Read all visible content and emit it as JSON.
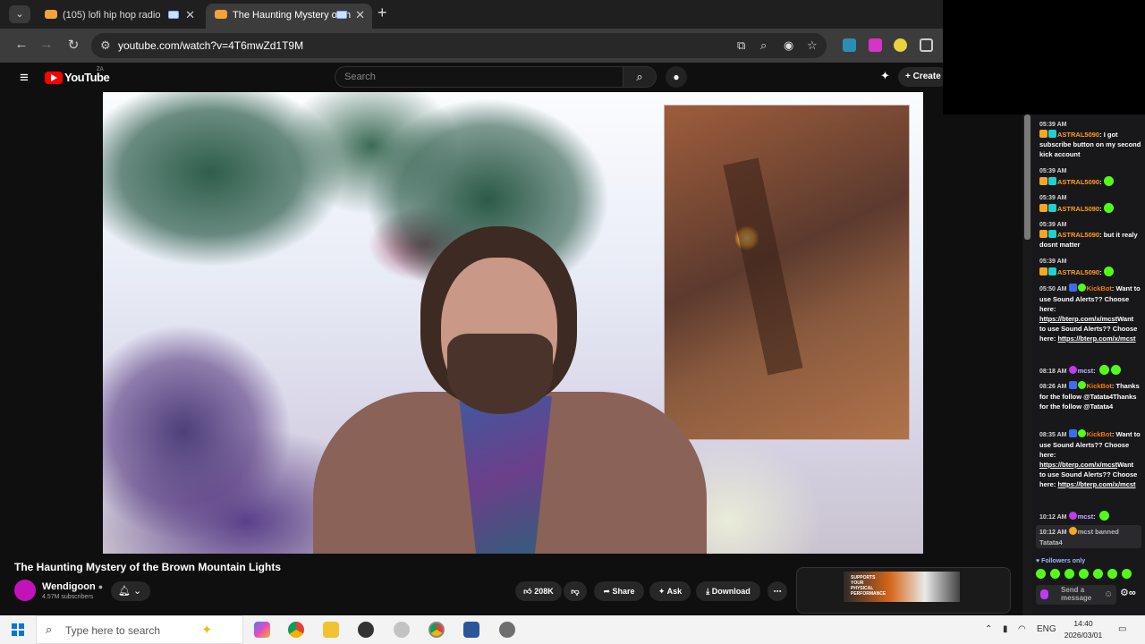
{
  "browser": {
    "tabs": [
      {
        "title": "(105) lofi hip hop radio",
        "close": "✕"
      },
      {
        "title": "The Haunting Mystery of th",
        "close": "✕",
        "active": true
      }
    ],
    "new_tab": "+",
    "url": "youtube.com/watch?v=4T6mwZd1T9M"
  },
  "youtube": {
    "logo_text": "YouTube",
    "region": "ZA",
    "search_placeholder": "Search",
    "create_label": "Create",
    "video_title": "The Haunting Mystery of the Brown Mountain Lights",
    "channel_name": "Wendigoon",
    "subscribers": "4.57M subscribers",
    "like_count": "208K",
    "share_label": "Share",
    "ask_label": "Ask",
    "download_label": "Download",
    "ad_text": "SUPPORTS YOUR PHYSICAL PERFORMANCE"
  },
  "chat": {
    "messages": [
      {
        "time": "05:39 AM",
        "user": "ASTRAL5090",
        "text": ": I got subscribe button on my second kick account"
      },
      {
        "time": "05:39 AM",
        "user": "ASTRAL5090",
        "text": ":"
      },
      {
        "time": "05:39 AM",
        "user": "ASTRAL5090",
        "text": ":"
      },
      {
        "time": "05:39 AM",
        "user": "ASTRAL5090",
        "text": ": but it realy dosnt matter"
      },
      {
        "time": "05:39 AM",
        "user": "ASTRAL5090",
        "text": ":"
      }
    ],
    "kick1": {
      "time": "05:50 AM",
      "user": "KickBot",
      "text": "Want to use Sound Alerts?? Choose here:",
      "link1": "https://bterp.com/x/mcst",
      "text2": "Want to use Sound Alerts?? Choose here:",
      "link2": "https://bterp.com/x/mcst"
    },
    "mcst1": {
      "time": "08:18 AM",
      "user": "mcst"
    },
    "kick2": {
      "time": "08:26 AM",
      "user": "KickBot",
      "text": "Thanks for the follow @Tatata4Thanks for the follow @Tatata4"
    },
    "kick3": {
      "time": "08:35 AM",
      "user": "KickBot",
      "text": "Want to use Sound Alerts?? Choose here:",
      "link1": "https://bterp.com/x/mcst",
      "text2": "Want to use Sound Alerts?? Choose here:",
      "link2": "https://bterp.com/x/mcst"
    },
    "mcst2": {
      "time": "10:12 AM",
      "user": "mcst"
    },
    "banned": {
      "time": "10:12 AM",
      "text": "mcst banned Tatata4"
    },
    "followers_only": "Followers only",
    "send_placeholder": "Send a message"
  },
  "taskbar": {
    "search_placeholder": "Type here to search",
    "language": "ENG",
    "time": "14:40",
    "date": "2026/03/01"
  }
}
